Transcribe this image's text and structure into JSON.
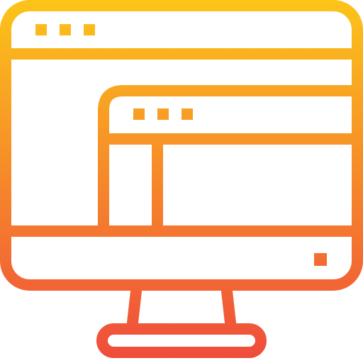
{
  "icon": {
    "name": "computer-monitor-with-browser-windows-icon",
    "gradient_top": "#fcc419",
    "gradient_bottom": "#ef4b3c"
  }
}
